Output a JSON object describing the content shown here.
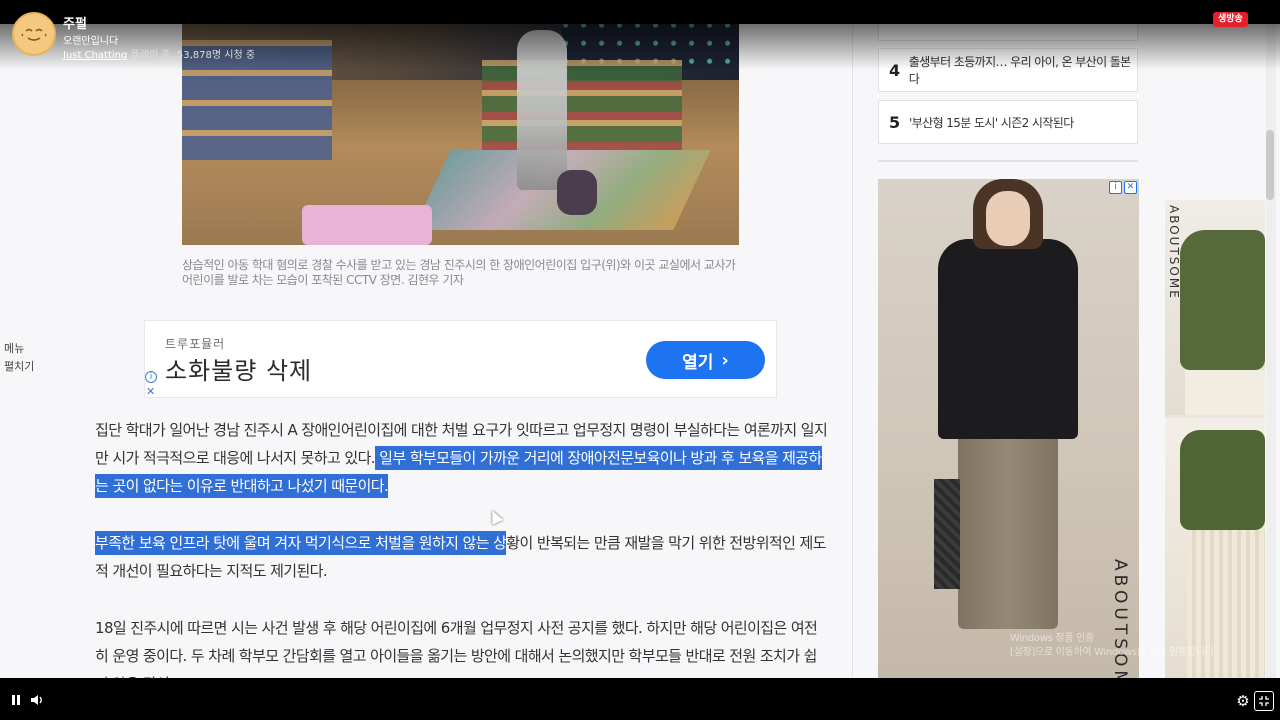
{
  "stream": {
    "streamer_name": "주펄",
    "title": "오랜만입니다",
    "category": "Just Chatting",
    "meta_suffix": "플레이 중, 53,878명 시청 중",
    "live_badge": "생방송"
  },
  "article": {
    "photo_caption": "상습적인 아동 학대 혐의로 경찰 수사를 받고 있는 경남 진주시의 한 장애인어린이집 입구(위)와 이곳 교실에서 교사가 어린이를 발로 차는 모습이 포착된 CCTV 장면. 김현우 기자",
    "side_menu": [
      "메뉴",
      "펼치기"
    ],
    "ad": {
      "advertiser": "트루포뮬러",
      "headline": "소화불량 삭제",
      "button_label": "열기",
      "info_icon": "info-icon",
      "close_icon": "close-icon"
    },
    "paragraphs": [
      {
        "plain": "집단 학대가 일어난 경남 진주시 A 장애인어린이집에 대한 처벌 요구가 잇따르고 업무정지 명령이 부실하다는 여론까지 일지만 시가 적극적으로 대응에 나서지 못하고 있다.",
        "highlight": " 일부 학부모들이 가까운 거리에 장애아전문보육이나 방과 후 보육을 제공하는 곳이 없다는 이유로 반대하고 나섰기 때문이다."
      },
      {
        "highlight": "부족한 보육 인프라 탓에 울며 겨자 먹기식으로 처벌을 원하지 않는 상",
        "plain": "황이 반복되는 만큼 재발을 막기 위한 전방위적인 제도적 개선이 필요하다는 지적도 제기된다."
      },
      {
        "plain": "18일 진주시에 따르면 시는 사건 발생 후 해당 어린이집에 6개월 업무정지 사전 공지를 했다. 하지만 해당 어린이집은 여전히 운영 중이다. 두 차례 학부모 간담회를 열고 아이들을 옮기는 방안에 대해서 논의했지만 학부모들 반대로 전원 조치가 쉽지 않은 탓이"
      }
    ]
  },
  "sidebar": {
    "ranking": [
      {
        "num": "4",
        "text": "출생부터 초등까지… 우리 아이, 온 부산이 돌본다"
      },
      {
        "num": "5",
        "text": "'부산형 15분 도시' 시즌2 시작된다"
      }
    ],
    "ad_brand": "ABOUTSOME",
    "ad2_brand": "ABOUTSOME"
  },
  "watermark": [
    "Windows 정품 인증",
    "[설정]으로 이동하여 Windows를 정품 인증합니다."
  ],
  "controls": {
    "pause_icon": "pause-icon",
    "volume_icon": "volume-icon",
    "settings_icon": "gear-icon",
    "exit_fullscreen_icon": "exit-fullscreen-icon"
  },
  "colors": {
    "highlight": "#2f6fd6",
    "live_badge": "#e4202b",
    "ad_button": "#1e73f0"
  }
}
